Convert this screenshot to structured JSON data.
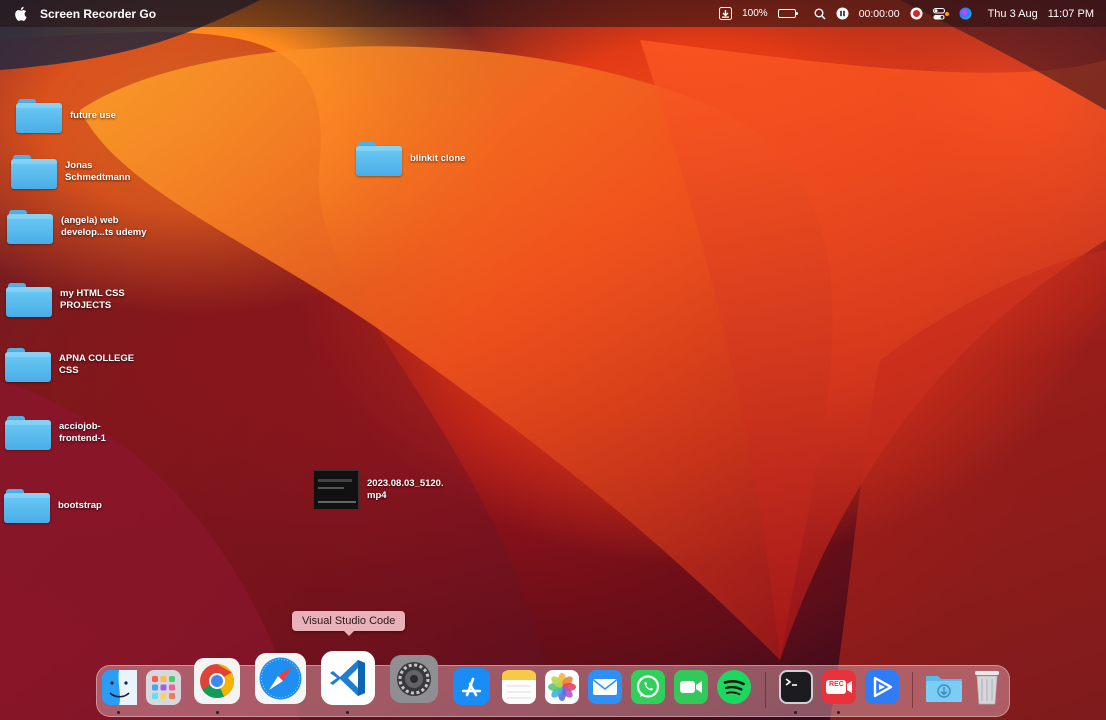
{
  "menubar": {
    "app_name": "Screen Recorder Go",
    "battery_percent": "100%",
    "recording_time": "00:00:00",
    "date": "Thu 3 Aug",
    "time": "11:07 PM"
  },
  "desktop": {
    "items": [
      {
        "name": "future use",
        "type": "folder"
      },
      {
        "name": "Jonas\nSchmedtmann",
        "type": "folder"
      },
      {
        "name": "(angela) web\ndevelop...ts udemy",
        "type": "folder"
      },
      {
        "name": "my HTML CSS\nPROJECTS",
        "type": "folder"
      },
      {
        "name": "APNA COLLEGE\nCSS",
        "type": "folder"
      },
      {
        "name": "acciojob-\nfrontend-1",
        "type": "folder"
      },
      {
        "name": "bootstrap",
        "type": "folder"
      },
      {
        "name": "blinkit clone",
        "type": "folder"
      },
      {
        "name": "2023.08.03_5120.\nmp4",
        "type": "video"
      }
    ]
  },
  "tooltip": "Visual Studio Code",
  "dock": {
    "apps": [
      {
        "name": "Finder",
        "icon": "finder-icon",
        "running": true
      },
      {
        "name": "Launchpad",
        "icon": "launchpad-icon",
        "running": false
      },
      {
        "name": "Google Chrome",
        "icon": "chrome-icon",
        "running": true
      },
      {
        "name": "Safari",
        "icon": "safari-icon",
        "running": false
      },
      {
        "name": "Visual Studio Code",
        "icon": "vscode-icon",
        "running": true
      },
      {
        "name": "System Settings",
        "icon": "settings-icon",
        "running": false
      },
      {
        "name": "App Store",
        "icon": "app-store-icon",
        "running": false
      },
      {
        "name": "Notes",
        "icon": "notes-icon",
        "running": false
      },
      {
        "name": "Photos",
        "icon": "photos-icon",
        "running": false
      },
      {
        "name": "Mail",
        "icon": "mail-icon",
        "running": false
      },
      {
        "name": "WhatsApp",
        "icon": "whatsapp-icon",
        "running": false
      },
      {
        "name": "FaceTime",
        "icon": "facetime-icon",
        "running": false
      },
      {
        "name": "Spotify",
        "icon": "spotify-icon",
        "running": false
      },
      {
        "name": "Terminal",
        "icon": "terminal-icon",
        "running": true
      },
      {
        "name": "Screen Recorder Go",
        "icon": "rec-icon",
        "running": true
      },
      {
        "name": "Video Player",
        "icon": "video-player-icon",
        "running": false
      },
      {
        "name": "Downloads",
        "icon": "downloads-folder-icon",
        "running": false
      },
      {
        "name": "Trash",
        "icon": "trash-icon",
        "running": false
      }
    ],
    "rec_badge": "REC"
  }
}
